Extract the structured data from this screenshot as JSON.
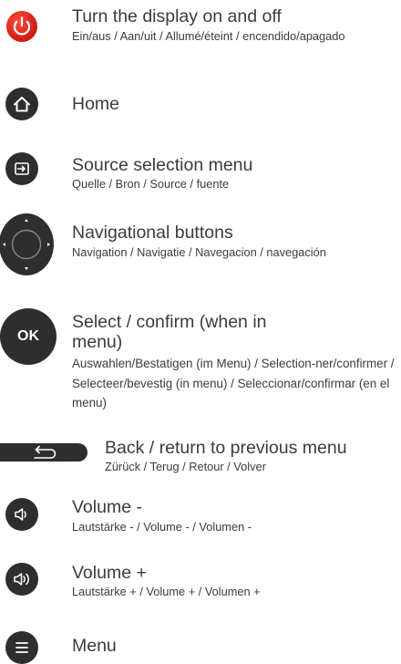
{
  "items": [
    {
      "icon": "power-icon",
      "title": "Turn the display on and off",
      "subtitle": "Ein/aus / Aan/uit / Allumé/éteint / encendido/apagado"
    },
    {
      "icon": "home-icon",
      "title": "Home",
      "subtitle": ""
    },
    {
      "icon": "source-icon",
      "title": "Source selection menu",
      "subtitle": "Quelle / Bron / Source / fuente"
    },
    {
      "icon": "navigation-pad-icon",
      "title": "Navigational buttons",
      "subtitle": "Navigation / Navigatie / Navegacion / navegación"
    },
    {
      "icon": "ok-icon",
      "icon_label": "OK",
      "title": "Select / confirm (when in menu)",
      "subtitle": "Auswahlen/Bestatigen (im Menu) / Selection-ner/confirmer / Selecteer/bevestig (in menu) / Seleccionar/confirmar (en el menu)"
    },
    {
      "icon": "back-icon",
      "title": "Back / return to previous menu",
      "subtitle": "Zürück / Terug / Retour / Volver"
    },
    {
      "icon": "volume-down-icon",
      "title": "Volume -",
      "subtitle": "Lautstärke - / Volume - / Volumen -"
    },
    {
      "icon": "volume-up-icon",
      "title": "Volume +",
      "subtitle": "Lautstärke + / Volume + / Volumen +"
    },
    {
      "icon": "menu-icon",
      "title": "Menu",
      "subtitle": ""
    }
  ],
  "colors": {
    "power_button": "#e2231a",
    "button_body": "#2e2e2e",
    "text": "#3c3c3c"
  }
}
